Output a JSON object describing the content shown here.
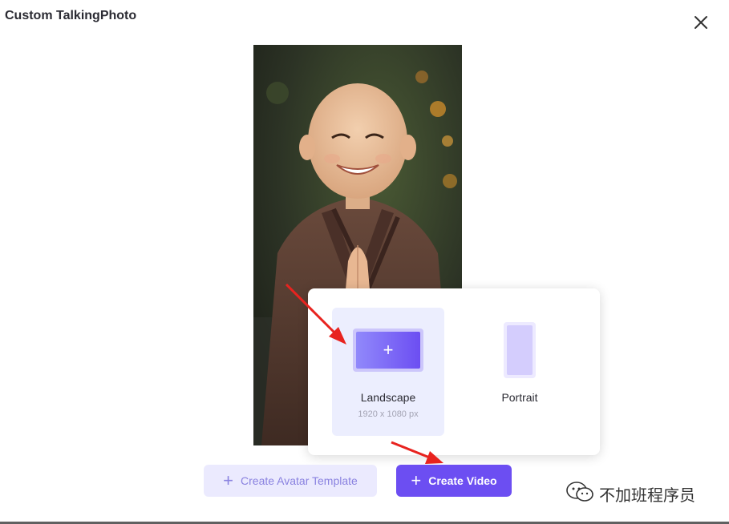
{
  "dialog": {
    "title": "Custom TalkingPhoto"
  },
  "icons": {
    "close": "close-icon",
    "plus": "plus-icon",
    "watermark": "wechat-logo-icon"
  },
  "video_format_menu": {
    "options": [
      {
        "label": "Landscape",
        "sublabel": "1920 x 1080 px",
        "selected": true
      },
      {
        "label": "Portrait"
      }
    ]
  },
  "actions": {
    "create_avatar_template_label": "Create Avatar Template",
    "create_video_label": "Create Video",
    "plus_glyph": "+"
  },
  "watermark": {
    "text": "不加班程序员"
  },
  "colors": {
    "accent": "#6c4ef2",
    "accent_light": "#ebeafe",
    "selected_bg": "#eceefe",
    "annotation_arrow": "#e8231f"
  }
}
